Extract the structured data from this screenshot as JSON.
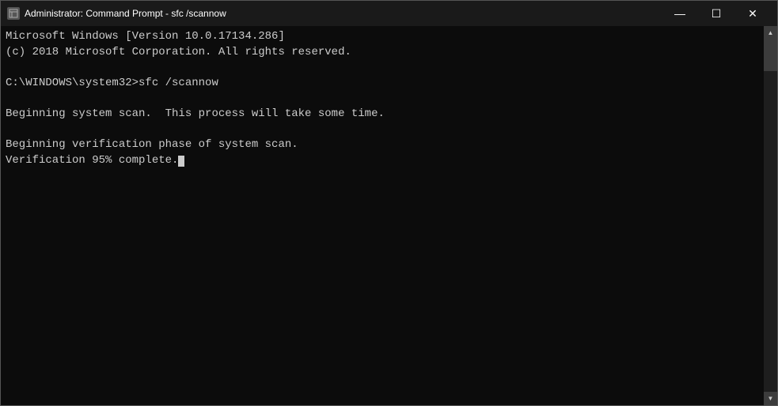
{
  "titleBar": {
    "icon": "cmd-icon",
    "title": "Administrator: Command Prompt - sfc /scannow",
    "minimizeLabel": "—",
    "maximizeLabel": "☐",
    "closeLabel": "✕"
  },
  "terminal": {
    "lines": [
      "Microsoft Windows [Version 10.0.17134.286]",
      "(c) 2018 Microsoft Corporation. All rights reserved.",
      "",
      "C:\\WINDOWS\\system32>sfc /scannow",
      "",
      "Beginning system scan.  This process will take some time.",
      "",
      "Beginning verification phase of system scan.",
      "Verification 95% complete."
    ]
  }
}
